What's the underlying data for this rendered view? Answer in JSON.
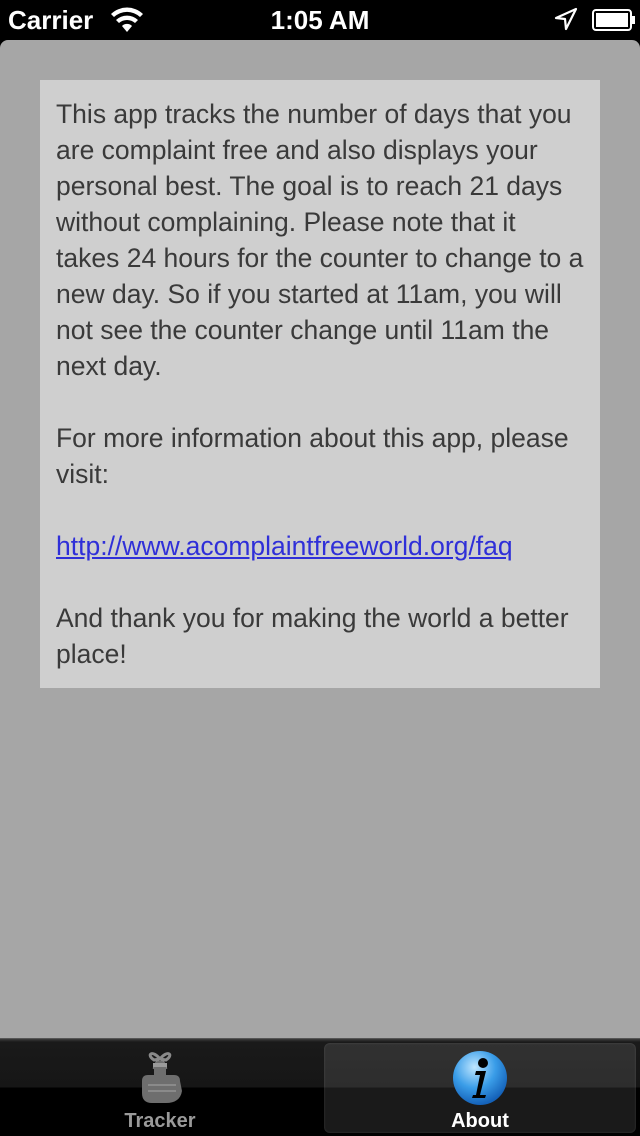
{
  "status_bar": {
    "carrier": "Carrier",
    "time": "1:05 AM",
    "icons": [
      "wifi-icon",
      "location-icon",
      "battery-icon"
    ]
  },
  "about": {
    "paragraph_1": "This app tracks the number of days that you are complaint free and also displays your personal best. The goal is to reach 21 days without complaining. Please note that it takes 24 hours for the counter to change to a new day. So if you started at 11am, you will not see the counter change until 11am the next day.",
    "paragraph_2": "For more information about this app, please visit:",
    "link": "http://www.acomplaintfreeworld.org/faq",
    "paragraph_3": "And thank you for making the world a better place!"
  },
  "tab_bar": {
    "tabs": [
      {
        "label": "Tracker",
        "icon": "finger-string-icon",
        "selected": false
      },
      {
        "label": "About",
        "icon": "info-icon",
        "selected": true
      }
    ]
  },
  "colors": {
    "background": "#a6a6a6",
    "card": "#cfcfcf",
    "link": "#2f2fd8",
    "selected_icon": "#3a9de8"
  }
}
